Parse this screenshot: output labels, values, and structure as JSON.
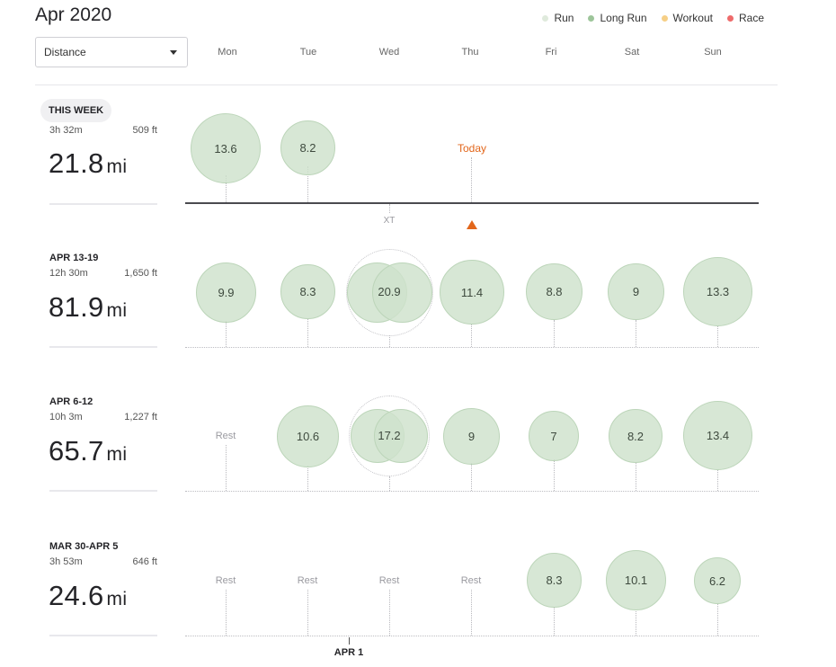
{
  "header": {
    "month": "Apr 2020",
    "metric_select": {
      "value": "Distance"
    }
  },
  "legend": [
    {
      "label": "Run",
      "color": "#dfeadc"
    },
    {
      "label": "Long Run",
      "color": "#9dc59a"
    },
    {
      "label": "Workout",
      "color": "#f6cf86"
    },
    {
      "label": "Race",
      "color": "#ee6b6b"
    }
  ],
  "days": [
    "Mon",
    "Tue",
    "Wed",
    "Thu",
    "Fri",
    "Sat",
    "Sun"
  ],
  "colors": {
    "accent": "#e2661b",
    "bubble_fill": "#cfe2cc"
  },
  "markers": {
    "today": "Today",
    "cross_training": "XT",
    "month_start": "APR 1"
  },
  "weeks": [
    {
      "label": "THIS WEEK",
      "time": "3h 32m",
      "elevation": "509 ft",
      "distance": "21.8",
      "unit": "mi",
      "days": [
        {
          "value": "13.6"
        },
        {
          "value": "8.2"
        }
      ]
    },
    {
      "label": "APR 13-19",
      "time": "12h 30m",
      "elevation": "1,650 ft",
      "distance": "81.9",
      "unit": "mi",
      "days": [
        {
          "value": "9.9"
        },
        {
          "value": "8.3"
        },
        {
          "value": "20.9"
        },
        {
          "value": "11.4"
        },
        {
          "value": "8.8"
        },
        {
          "value": "9"
        },
        {
          "value": "13.3"
        }
      ]
    },
    {
      "label": "APR 6-12",
      "time": "10h 3m",
      "elevation": "1,227 ft",
      "distance": "65.7",
      "unit": "mi",
      "days": [
        {
          "rest": "Rest"
        },
        {
          "value": "10.6"
        },
        {
          "value": "17.2"
        },
        {
          "value": "9"
        },
        {
          "value": "7"
        },
        {
          "value": "8.2"
        },
        {
          "value": "13.4"
        }
      ]
    },
    {
      "label": "MAR 30-APR 5",
      "time": "3h 53m",
      "elevation": "646 ft",
      "distance": "24.6",
      "unit": "mi",
      "days": [
        {
          "rest": "Rest"
        },
        {
          "rest": "Rest"
        },
        {
          "rest": "Rest"
        },
        {
          "rest": "Rest"
        },
        {
          "value": "8.3"
        },
        {
          "value": "10.1"
        },
        {
          "value": "6.2"
        }
      ]
    }
  ]
}
